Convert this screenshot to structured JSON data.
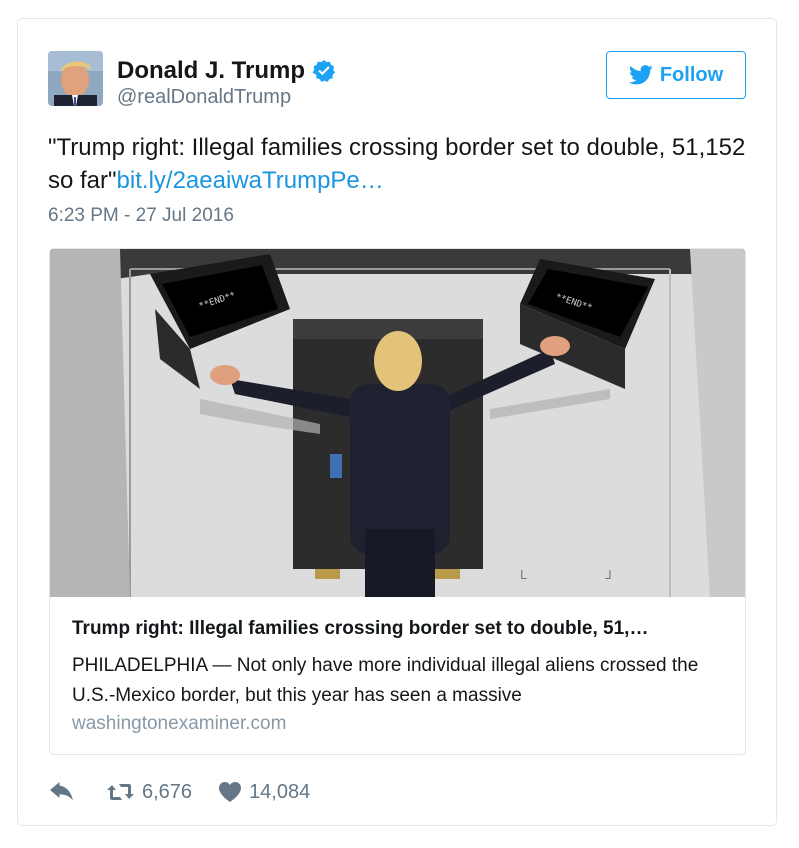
{
  "user": {
    "name": "Donald J. Trump",
    "handle": "@realDonaldTrump",
    "verified": true
  },
  "follow_button": {
    "label": "Follow"
  },
  "tweet": {
    "text": "\"Trump right: Illegal families crossing border set to double, 51,152 so far\"",
    "link": "bit.ly/2aeaiwaTrumpPe…",
    "timestamp": "6:23 PM - 27 Jul 2016"
  },
  "card": {
    "title": "Trump right: Illegal families crossing border set to double, 51,…",
    "description": "PHILADELPHIA — Not only have more individual illegal aliens crossed the U.S.-Mexico border, but this year has seen a massive",
    "domain": "washingtonexaminer.com"
  },
  "actions": {
    "retweets": "6,676",
    "likes": "14,084"
  },
  "colors": {
    "accent": "#1da1f2",
    "link": "#1b95e0",
    "muted": "#657786",
    "border": "#e1e8ed"
  },
  "icons": [
    "verified-badge-icon",
    "bird-icon",
    "reply-icon",
    "retweet-icon",
    "heart-icon"
  ]
}
